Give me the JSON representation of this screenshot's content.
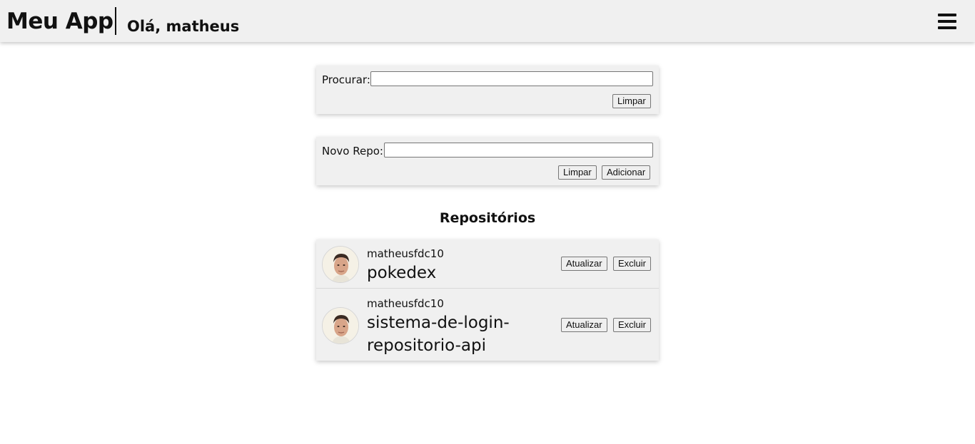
{
  "header": {
    "brand": "Meu App",
    "greeting": "Olá, matheus",
    "menu_icon": "hamburger-menu-icon"
  },
  "search": {
    "label": "Procurar:",
    "value": "",
    "placeholder": "",
    "clear_label": "Limpar"
  },
  "new_repo": {
    "label": "Novo Repo:",
    "value": "",
    "placeholder": "",
    "clear_label": "Limpar",
    "add_label": "Adicionar"
  },
  "repositories": {
    "title": "Repositórios",
    "items": [
      {
        "owner": "matheusfdc10",
        "name": "pokedex",
        "update_label": "Atualizar",
        "delete_label": "Excluir"
      },
      {
        "owner": "matheusfdc10",
        "name": "sistema-de-login-repositorio-api",
        "update_label": "Atualizar",
        "delete_label": "Excluir"
      }
    ]
  },
  "colors": {
    "panel_bg": "#f0f0f0",
    "text": "#111111",
    "page_bg": "#ffffff"
  }
}
